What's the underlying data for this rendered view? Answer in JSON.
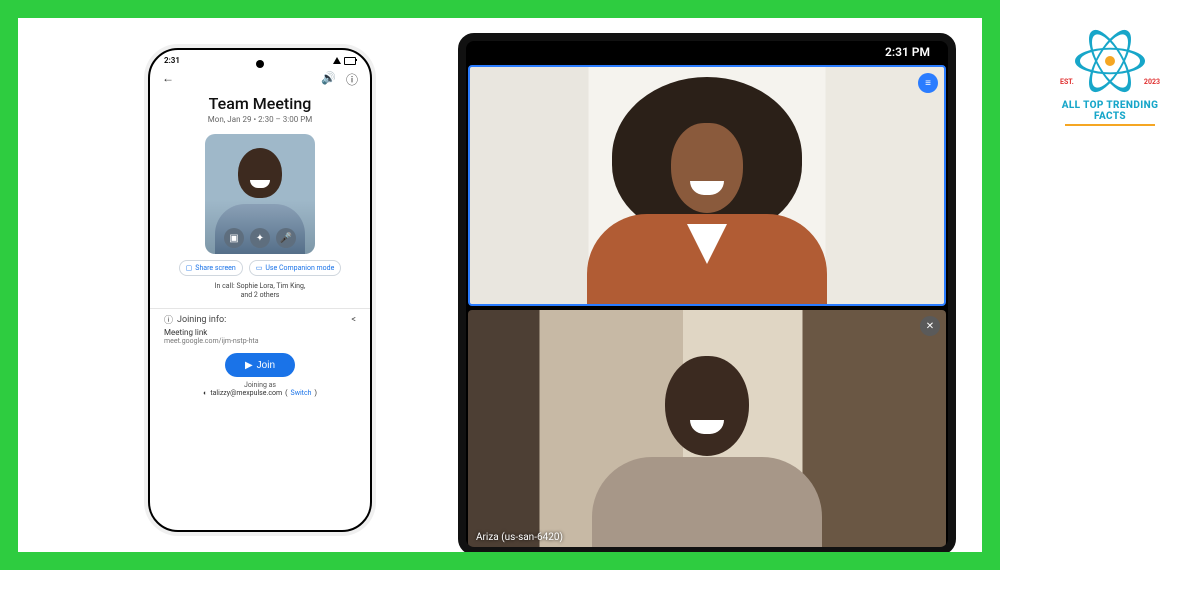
{
  "phone": {
    "status_time": "2:31",
    "meeting_title": "Team Meeting",
    "meeting_subtitle": "Mon, Jan 29 • 2:30 – 3:00 PM",
    "share_screen": "Share screen",
    "companion_mode": "Use Companion mode",
    "in_call_line1": "In call: Sophie Lora, Tim King,",
    "in_call_line2": "and 2 others",
    "joining_info_label": "Joining info:",
    "meeting_link_label": "Meeting link",
    "meeting_link_value": "meet.google.com/ijm-nstp-hta",
    "join_button": "Join",
    "joining_as_label": "Joining as",
    "joining_as_email": "talizzy@mexpulse.com",
    "switch_label": "Switch"
  },
  "tablet": {
    "status_time": "2:31 PM",
    "tile_b_label": "Ariza (us-san-6420)"
  },
  "logo": {
    "est": "EST.",
    "year": "2023",
    "name": "ALL TOP TRENDING FACTS"
  }
}
